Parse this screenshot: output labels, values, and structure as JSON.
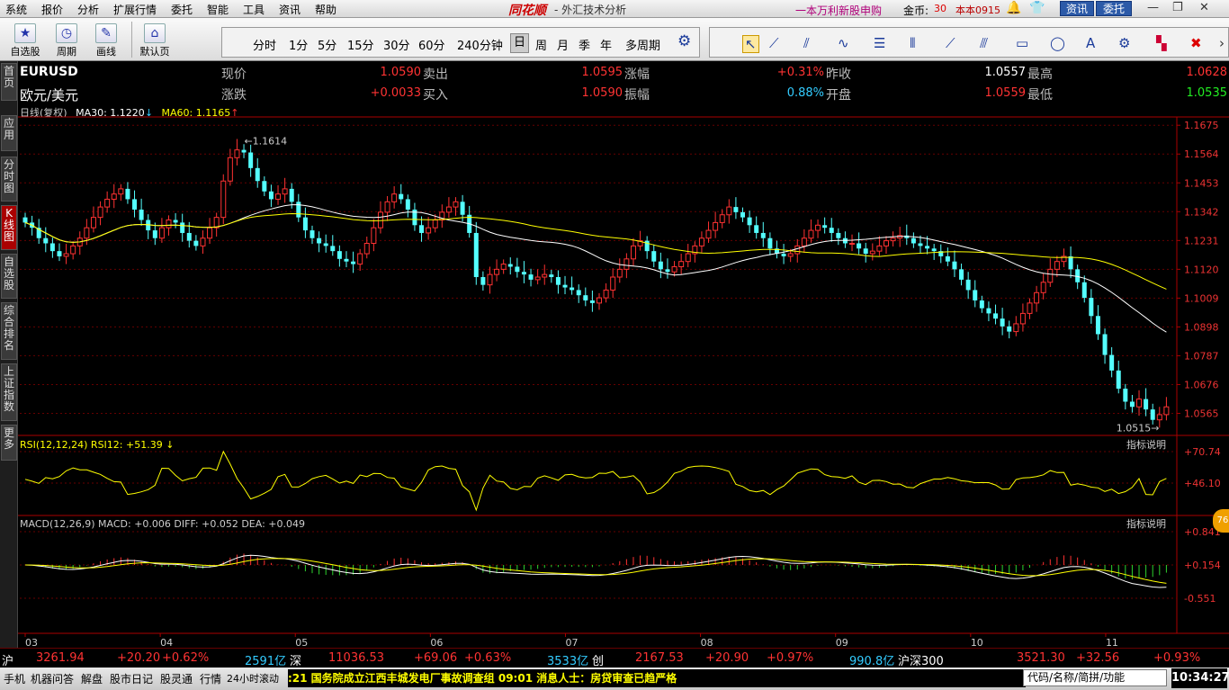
{
  "menu": {
    "items": [
      "系统",
      "报价",
      "分析",
      "扩展行情",
      "委托",
      "智能",
      "工具",
      "资讯",
      "帮助"
    ],
    "brand": "同花顺",
    "app_title": "- 外汇技术分析",
    "promo": "一本万利新股申购",
    "coins_label": "金币:",
    "coins_value": "30",
    "version": "本本0915",
    "news_btn": "资讯",
    "entrust_btn": "委托",
    "bell_icon": "bell-icon",
    "shirt_icon": "shirt-icon"
  },
  "toolbar": {
    "buttons": [
      {
        "label": "自选股",
        "icon": "star-icon"
      },
      {
        "label": "周期",
        "icon": "clock-icon"
      },
      {
        "label": "画线",
        "icon": "pencil-icon"
      },
      {
        "label": "默认页",
        "icon": "home-icon"
      }
    ],
    "periods": [
      "分时",
      "1分",
      "5分",
      "15分",
      "30分",
      "60分",
      "240分钟",
      "日",
      "周",
      "月",
      "季",
      "年",
      "多周期"
    ],
    "selected_period": "日",
    "settings_icon": "gear-icon"
  },
  "leftnav": [
    "首页",
    "应用",
    "分时图",
    "K线图",
    "自选股",
    "综合排名",
    "上证指数",
    "更多"
  ],
  "leftnav_active": "K线图",
  "quote": {
    "symbol": "EURUSD",
    "name": "欧元/美元",
    "labels": [
      "现价",
      "卖出",
      "涨幅",
      "昨收",
      "最高",
      "涨跌",
      "买入",
      "振幅",
      "开盘",
      "最低"
    ],
    "current": "1.0590",
    "ask": "1.0595",
    "change_pct": "+0.31%",
    "prev_close": "1.0557",
    "high": "1.0628",
    "change": "+0.0033",
    "bid": "1.0590",
    "amplitude": "0.88%",
    "open": "1.0559",
    "low": "1.0535"
  },
  "indicators": {
    "kline_label": "日线(复权)",
    "ma30": "MA30: 1.1220",
    "ma60": "MA60: 1.1165",
    "rsi": "RSI(12,12,24)  RSI12: +51.39",
    "macd_name": "MACD(12,26,9)",
    "macd_val": "MACD: +0.006",
    "diff": "DIFF: +0.052",
    "dea": "DEA: +0.049",
    "explain": "指标说明"
  },
  "chart_data": {
    "type": "candlestick",
    "symbol": "EURUSD",
    "y_ticks": [
      1.1675,
      1.1564,
      1.1453,
      1.1342,
      1.1231,
      1.112,
      1.1009,
      1.0898,
      1.0787,
      1.0676,
      1.0565
    ],
    "ylim": [
      1.048,
      1.17
    ],
    "x_ticks": [
      "03",
      "04",
      "05",
      "06",
      "07",
      "08",
      "09",
      "10",
      "11"
    ],
    "annotations": {
      "high": "1.1614",
      "low": "1.0515"
    },
    "rsi_ticks": [
      "+70.74",
      "+46.10"
    ],
    "macd_ticks": [
      "+0.841",
      "+0.154",
      "-0.551"
    ],
    "close": [
      1.13,
      1.128,
      1.124,
      1.122,
      1.119,
      1.117,
      1.118,
      1.121,
      1.124,
      1.128,
      1.132,
      1.136,
      1.139,
      1.141,
      1.143,
      1.139,
      1.135,
      1.131,
      1.127,
      1.124,
      1.128,
      1.131,
      1.13,
      1.126,
      1.123,
      1.121,
      1.124,
      1.128,
      1.132,
      1.146,
      1.155,
      1.158,
      1.157,
      1.151,
      1.146,
      1.142,
      1.139,
      1.141,
      1.143,
      1.138,
      1.132,
      1.127,
      1.124,
      1.122,
      1.121,
      1.119,
      1.116,
      1.115,
      1.114,
      1.118,
      1.122,
      1.128,
      1.134,
      1.138,
      1.141,
      1.139,
      1.135,
      1.129,
      1.126,
      1.128,
      1.131,
      1.134,
      1.136,
      1.138,
      1.133,
      1.126,
      1.109,
      1.106,
      1.11,
      1.112,
      1.114,
      1.113,
      1.111,
      1.11,
      1.108,
      1.109,
      1.11,
      1.109,
      1.106,
      1.105,
      1.104,
      1.102,
      1.1,
      1.099,
      1.101,
      1.104,
      1.109,
      1.112,
      1.116,
      1.121,
      1.123,
      1.119,
      1.115,
      1.112,
      1.111,
      1.113,
      1.115,
      1.118,
      1.121,
      1.124,
      1.127,
      1.13,
      1.133,
      1.136,
      1.134,
      1.132,
      1.129,
      1.126,
      1.124,
      1.12,
      1.118,
      1.117,
      1.118,
      1.121,
      1.124,
      1.127,
      1.129,
      1.128,
      1.126,
      1.124,
      1.122,
      1.122,
      1.12,
      1.118,
      1.119,
      1.121,
      1.123,
      1.124,
      1.125,
      1.124,
      1.122,
      1.121,
      1.12,
      1.119,
      1.117,
      1.115,
      1.112,
      1.108,
      1.104,
      1.1,
      1.097,
      1.095,
      1.093,
      1.09,
      1.088,
      1.091,
      1.095,
      1.099,
      1.103,
      1.107,
      1.112,
      1.115,
      1.117,
      1.112,
      1.107,
      1.101,
      1.094,
      1.087,
      1.079,
      1.073,
      1.066,
      1.061,
      1.059,
      1.062,
      1.058,
      1.054,
      1.056,
      1.059
    ]
  },
  "status": {
    "sh_label": "沪",
    "sh_value": "3261.94",
    "sh_change": "+20.20",
    "sh_pct": "+0.62%",
    "sh_vol": "2591亿",
    "sz_label": "深",
    "sz_value": "11036.53",
    "sz_change": "+69.06",
    "sz_pct": "+0.63%",
    "sz_vol": "3533亿",
    "cy_label": "创",
    "cy_value": "2167.53",
    "cy_change": "+20.90",
    "cy_pct": "+0.97%",
    "cy_vol": "990.8亿",
    "hs_label": "沪深300",
    "hs_value": "3521.30",
    "hs_change": "+32.56",
    "hs_pct": "+0.93%"
  },
  "bottom": {
    "items": [
      "手机",
      "机器问答",
      "解盘",
      "股市日记",
      "股灵通",
      "行情",
      "24小时滚动"
    ],
    "ticker": ":21 国务院成立江西丰城发电厂事故调查组          09:01 消息人士：房贷审查已趋严格",
    "code_placeholder": "代码/名称/简拼/功能",
    "clock": "10:34:27",
    "badge": "76"
  }
}
